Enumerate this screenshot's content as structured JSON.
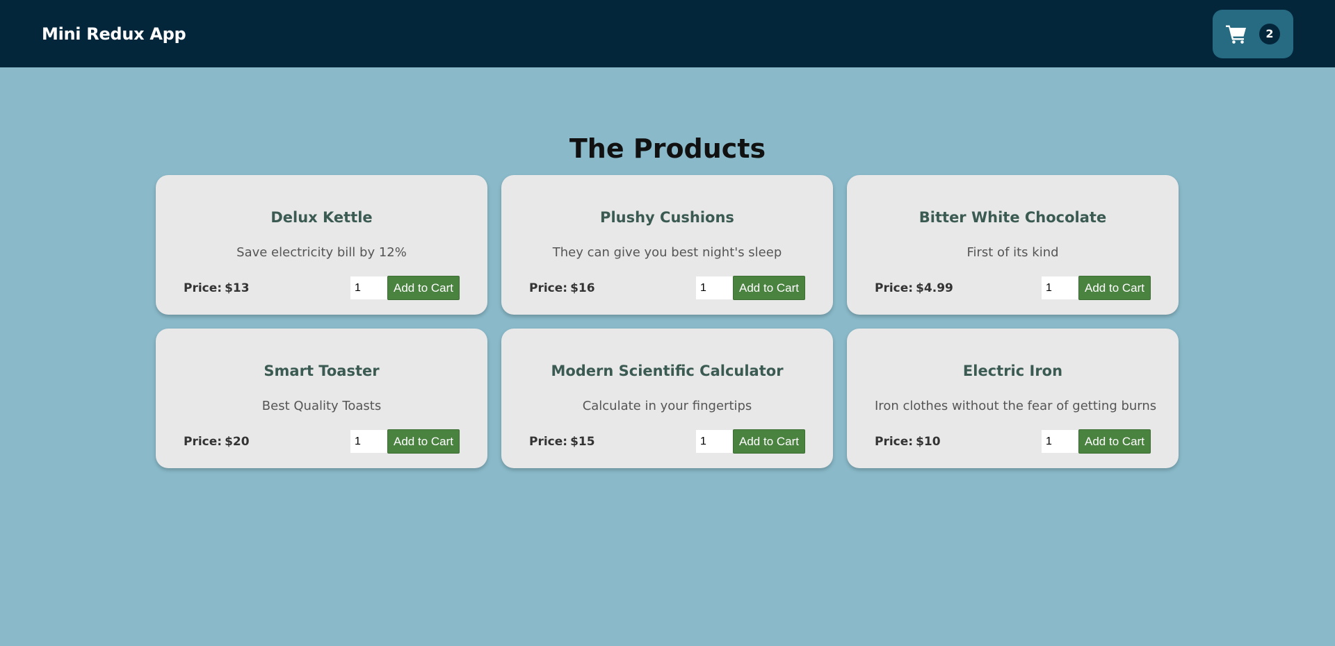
{
  "header": {
    "app_title": "Mini Redux App",
    "cart_icon": "shopping-cart-icon",
    "cart_count": "2"
  },
  "main": {
    "title": "The Products",
    "price_label": "Price:",
    "add_button_label": "Add to Cart",
    "products": [
      {
        "title": "Delux Kettle",
        "description": "Save electricity bill by 12%",
        "price": "$13",
        "quantity": "1"
      },
      {
        "title": "Plushy Cushions",
        "description": "They can give you best night's sleep",
        "price": "$16",
        "quantity": "1"
      },
      {
        "title": "Bitter White Chocolate",
        "description": "First of its kind",
        "price": "$4.99",
        "quantity": "1"
      },
      {
        "title": "Smart Toaster",
        "description": "Best Quality Toasts",
        "price": "$20",
        "quantity": "1"
      },
      {
        "title": "Modern Scientific Calculator",
        "description": "Calculate in your fingertips",
        "price": "$15",
        "quantity": "1"
      },
      {
        "title": "Electric Iron",
        "description": "Iron clothes without the fear of getting burns",
        "price": "$10",
        "quantity": "1"
      }
    ]
  },
  "colors": {
    "header_bg": "#04263b",
    "page_bg": "#8abaca",
    "cart_button_bg": "#266b82",
    "card_bg": "#e8e8e8",
    "add_button_bg": "#4a8240",
    "card_title_color": "#3a5a52"
  }
}
